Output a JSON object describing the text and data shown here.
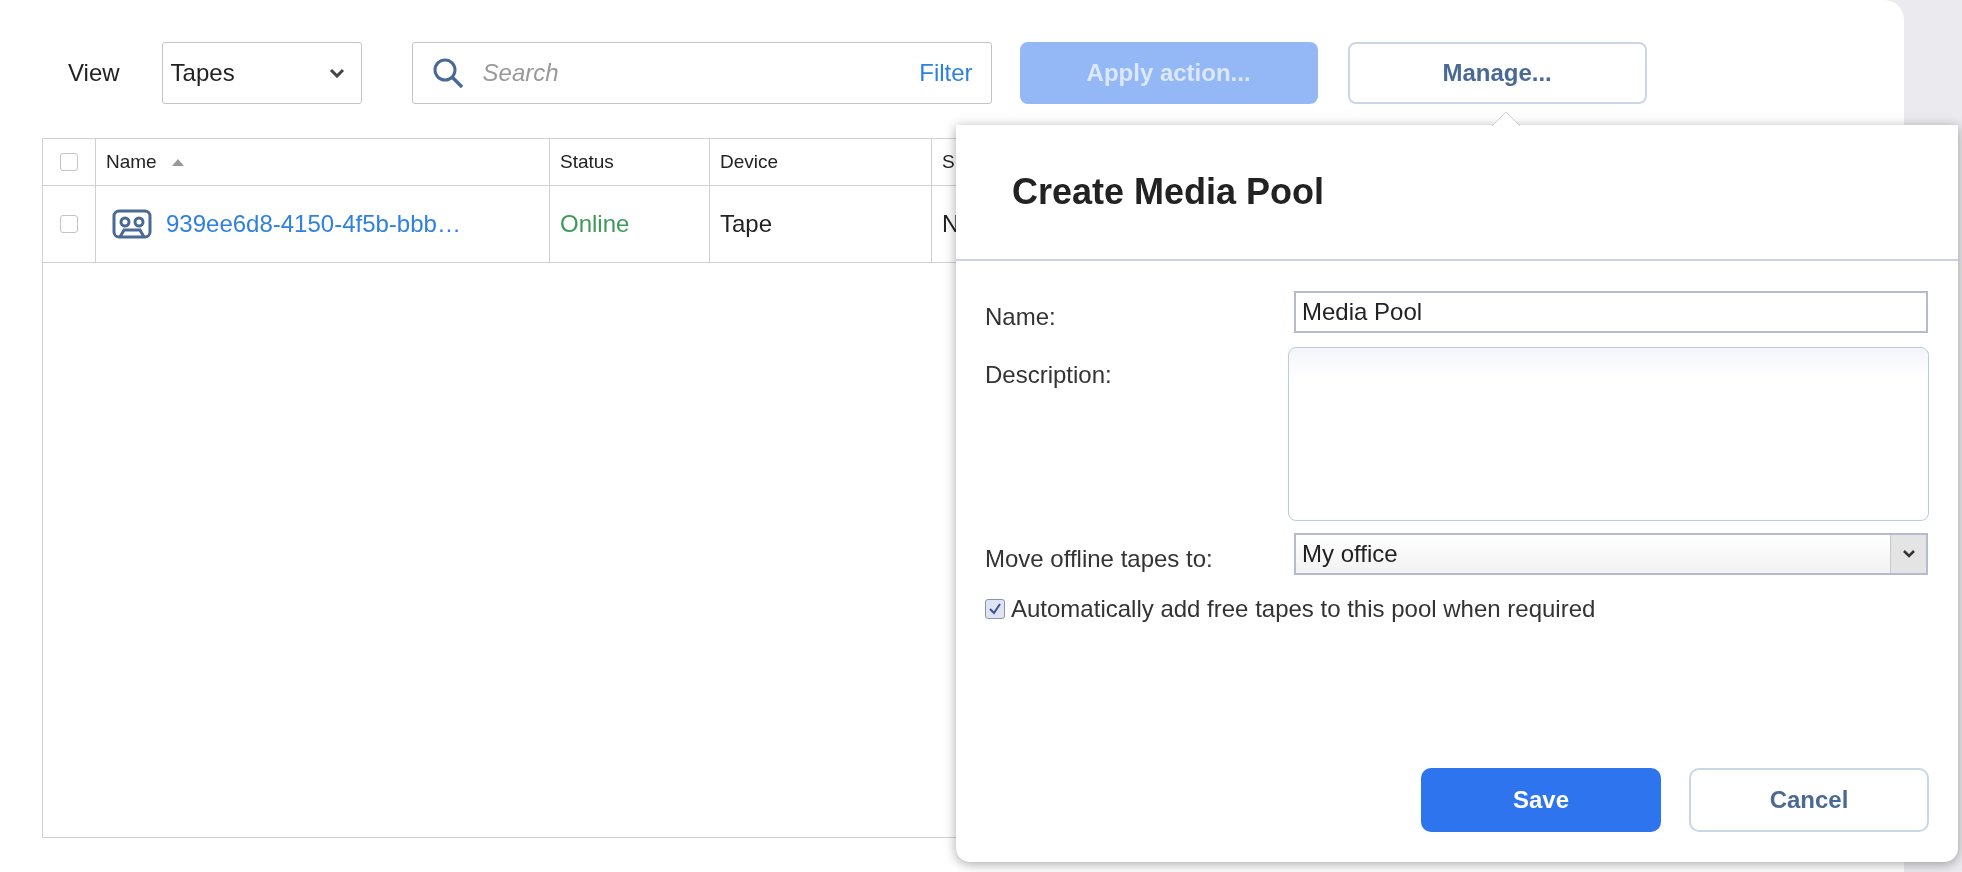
{
  "toolbar": {
    "view_label": "View",
    "view_select": "Tapes",
    "search": {
      "placeholder": "Search"
    },
    "filter": "Filter",
    "apply_button": {
      "label": "Apply action...",
      "disabled": true
    },
    "manage_button": "Manage..."
  },
  "table": {
    "columns": [
      {
        "label": "Name",
        "sorted": true
      },
      {
        "label": "Status",
        "sorted": false
      },
      {
        "label": "Device",
        "sorted": false
      },
      {
        "label": "S"
      }
    ],
    "header_checked": false,
    "rows": [
      {
        "checked": false,
        "name": "939ee6d8-4150-4f5b-bbb…",
        "status": "Online",
        "device": "Tape",
        "column_4": "N"
      }
    ]
  },
  "dialog": {
    "title": "Create Media Pool",
    "fields": [
      {
        "kind": "input",
        "label": "Name:",
        "value": "Media Pool"
      },
      {
        "kind": "textarea",
        "label": "Description:"
      },
      {
        "kind": "select",
        "label": "Move offline tapes to:",
        "value": "My office"
      }
    ],
    "checkbox": {
      "label": "Automatically add free tapes to this pool when required",
      "checked": true
    },
    "buttons": [
      {
        "label": "Save",
        "kind": "primary"
      },
      {
        "label": "Cancel",
        "kind": "secondary"
      }
    ]
  }
}
